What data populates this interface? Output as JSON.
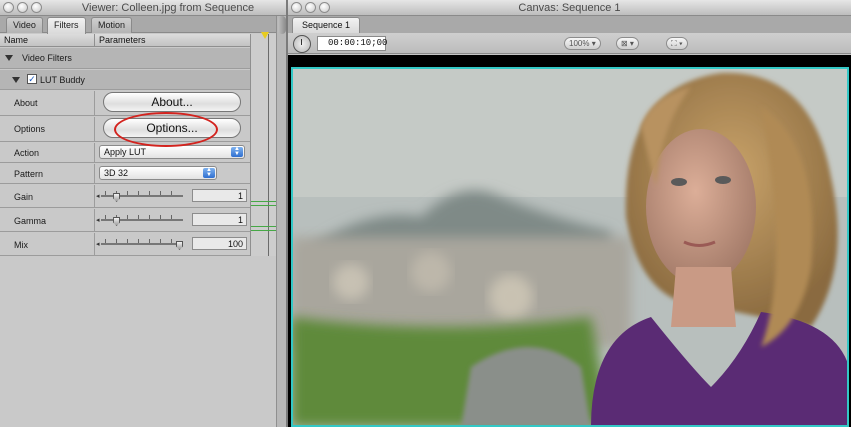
{
  "viewer": {
    "title": "Viewer: Colleen.jpg from Sequence",
    "tabs": [
      {
        "label": "Video"
      },
      {
        "label": "Filters"
      },
      {
        "label": "Motion"
      }
    ],
    "columns": {
      "name": "Name",
      "parameters": "Parameters"
    },
    "group": "Video Filters",
    "filter": {
      "label": "LUT Buddy",
      "enabled": true
    },
    "params": {
      "about": {
        "label": "About",
        "button": "About..."
      },
      "options": {
        "label": "Options",
        "button": "Options..."
      },
      "action": {
        "label": "Action",
        "value": "Apply LUT"
      },
      "pattern": {
        "label": "Pattern",
        "value": "3D 32"
      },
      "gain": {
        "label": "Gain",
        "value": "1",
        "level": 0.15
      },
      "gamma": {
        "label": "Gamma",
        "value": "1",
        "level": 0.15
      },
      "mix": {
        "label": "Mix",
        "value": "100",
        "level": 1.0
      }
    }
  },
  "canvas": {
    "title": "Canvas: Sequence 1",
    "tab": "Sequence 1",
    "timecode": "00:00:10;00",
    "zoom": "100%",
    "accent_border_color": "#33c8c6"
  },
  "annotation": {
    "color": "#d3231e"
  }
}
